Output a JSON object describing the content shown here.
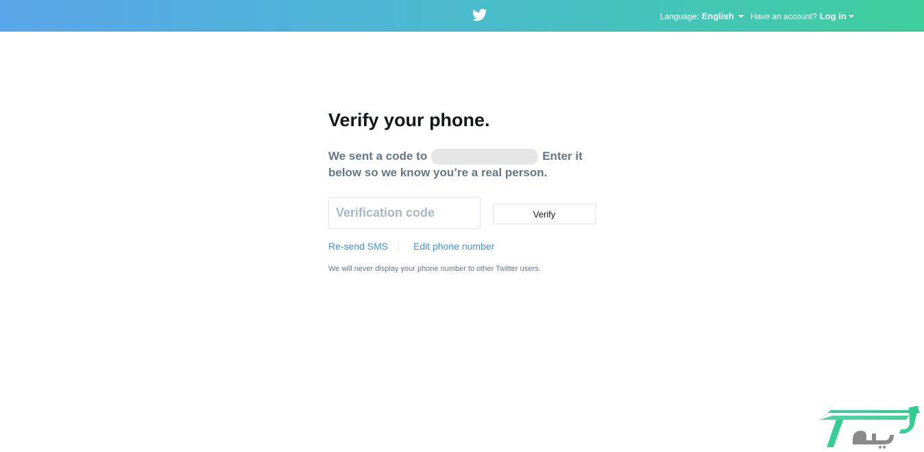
{
  "header": {
    "language_label": "Language:",
    "language_value": "English",
    "account_prompt": "Have an account?",
    "login_label": "Log in",
    "brand_color": "#1da1f2"
  },
  "main": {
    "title": "Verify your phone.",
    "desc_part1": "We sent a code to",
    "desc_part2": "Enter it",
    "desc_line2": "below so we know you’re a real person.",
    "code_placeholder": "Verification code",
    "verify_label": "Verify",
    "resend_label": "Re-send SMS",
    "edit_phone_label": "Edit phone number",
    "privacy_note": "We will never display your phone number to other Twitter users."
  },
  "icons": {
    "logo": "twitter-bird-icon",
    "language_caret": "chevron-down-icon",
    "login_caret": "chevron-down-icon"
  }
}
